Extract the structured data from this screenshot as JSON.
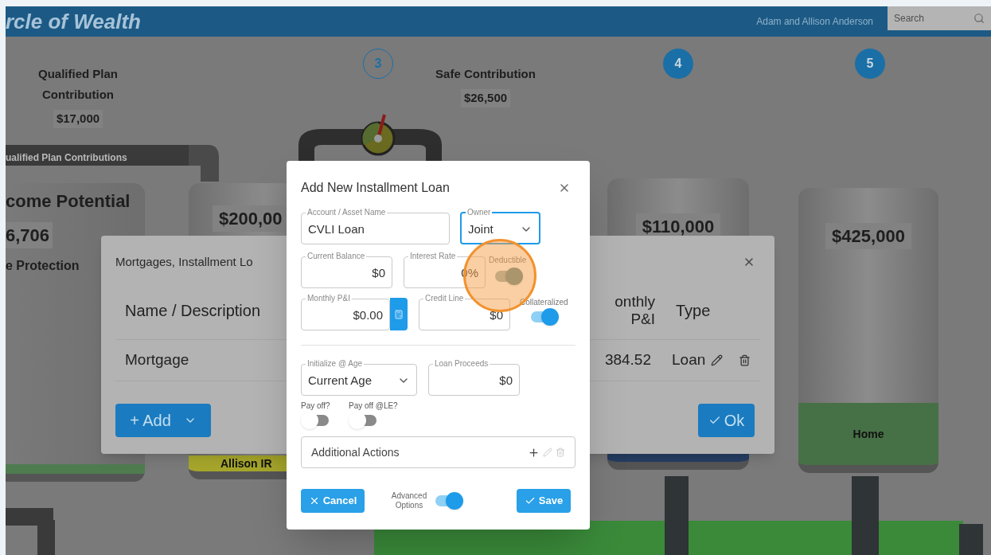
{
  "header": {
    "title": "rcle of Wealth",
    "user": "Adam and Allison Anderson",
    "search": {
      "placeholder": "Search"
    }
  },
  "steps": [
    {
      "number": "3",
      "filled": false
    },
    {
      "number": "4",
      "filled": true
    },
    {
      "number": "5",
      "filled": true
    }
  ],
  "contributions": [
    {
      "label": "Qualified Plan Contribution",
      "amount": "$17,000"
    },
    {
      "label": "Safe Contribution",
      "amount": "$26,500"
    }
  ],
  "pipe_label": "ualified Plan Contributions",
  "income_tank": {
    "title": "come Potential",
    "amount": "6,706",
    "subtitle": "e Protection"
  },
  "tanks": [
    {
      "amount": "$200,00",
      "label": "Allison IR",
      "color": "#a6a62c"
    },
    {
      "amount": "$110,000",
      "color": "#253e63"
    },
    {
      "amount": "$425,000",
      "label": "Home",
      "color": "#467046"
    }
  ],
  "list_dialog": {
    "title": "Mortgages, Installment Lo",
    "columns": [
      "Name / Description",
      "onthly P&I",
      "Type"
    ],
    "rows": [
      {
        "cells": [
          "Mortgage",
          "384.52",
          "Loan"
        ]
      }
    ],
    "add_button": "+ Add",
    "ok_button": "Ok"
  },
  "loan_dialog": {
    "title": "Add New Installment Loan",
    "account_name": {
      "label": "Account / Asset Name",
      "value": "CVLI Loan"
    },
    "owner": {
      "label": "Owner",
      "value": "Joint",
      "focused": true
    },
    "current_balance": {
      "label": "Current Balance",
      "value": "$0"
    },
    "interest_rate": {
      "label": "Interest Rate",
      "value": "0%"
    },
    "deductible": {
      "label": "Deductible",
      "on": true
    },
    "monthly_pi": {
      "label": "Monthly P&I",
      "value": "$0.00"
    },
    "credit_line": {
      "label": "Credit Line",
      "value": "$0"
    },
    "collateralized": {
      "label": "Collateralized",
      "on": true
    },
    "initialize_age": {
      "label": "Initialize @ Age",
      "value": "Current Age"
    },
    "loan_proceeds": {
      "label": "Loan Proceeds",
      "value": "$0"
    },
    "pay_off": {
      "label": "Pay off?",
      "on": false
    },
    "pay_off_le": {
      "label": "Pay off @LE?",
      "on": false
    },
    "additional_actions": "Additional Actions",
    "cancel_button": "Cancel",
    "advanced_options": {
      "label": "Advanced Options",
      "on": true
    },
    "save_button": "Save"
  }
}
